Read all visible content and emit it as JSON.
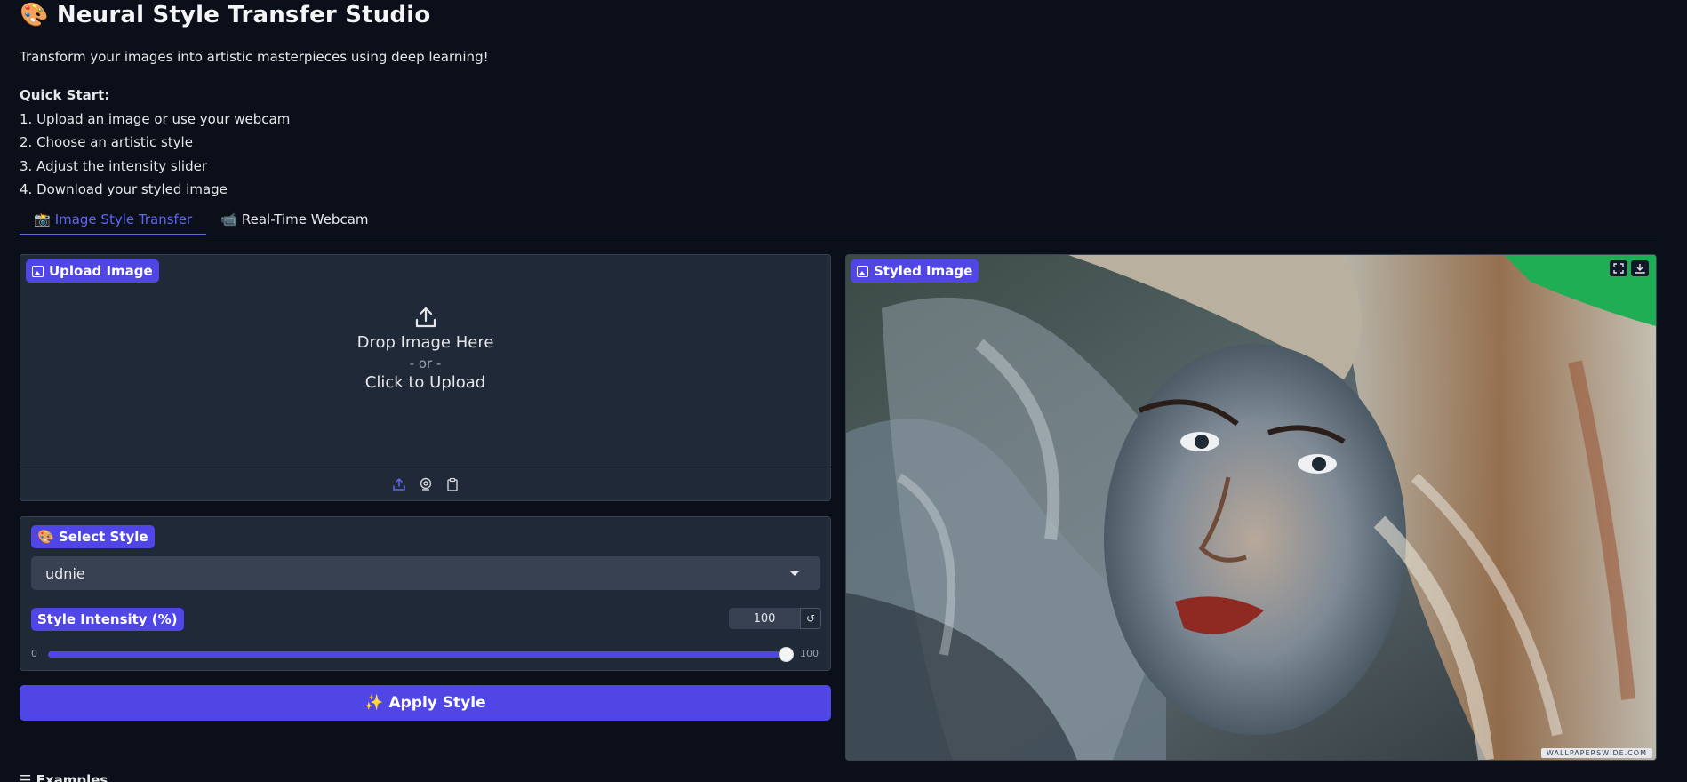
{
  "app": {
    "title": "🎨 Neural Style Transfer Studio",
    "subtitle": "Transform your images into artistic masterpieces using deep learning!"
  },
  "quick_start": {
    "title": "Quick Start:",
    "steps": [
      "1. Upload an image or use your webcam",
      "2. Choose an artistic style",
      "3. Adjust the intensity slider",
      "4. Download your styled image"
    ]
  },
  "tabs": [
    {
      "icon": "📸",
      "label": "Image Style Transfer",
      "active": true
    },
    {
      "icon": "📹",
      "label": "Real-Time Webcam",
      "active": false
    }
  ],
  "upload": {
    "label": "Upload Image",
    "drop_text": "Drop Image Here",
    "or_text": "- or -",
    "click_text": "Click to Upload",
    "sources": [
      "upload-icon",
      "webcam-icon",
      "clipboard-icon"
    ]
  },
  "style_select": {
    "label": "🎨 Select Style",
    "value": "udnie"
  },
  "intensity": {
    "label": "Style Intensity (%)",
    "value": "100",
    "min": "0",
    "max": "100",
    "fraction": 1.0
  },
  "apply_button": "✨ Apply Style",
  "output": {
    "label": "Styled Image",
    "watermark": "WALLPAPERSWIDE.COM",
    "tools": [
      "fullscreen-icon",
      "download-icon"
    ]
  },
  "examples_label": "☰ Examples",
  "colors": {
    "background": "#0b0f19",
    "panel": "#1f2937",
    "accent": "#4f46e5",
    "accent_text": "#6366f1"
  }
}
